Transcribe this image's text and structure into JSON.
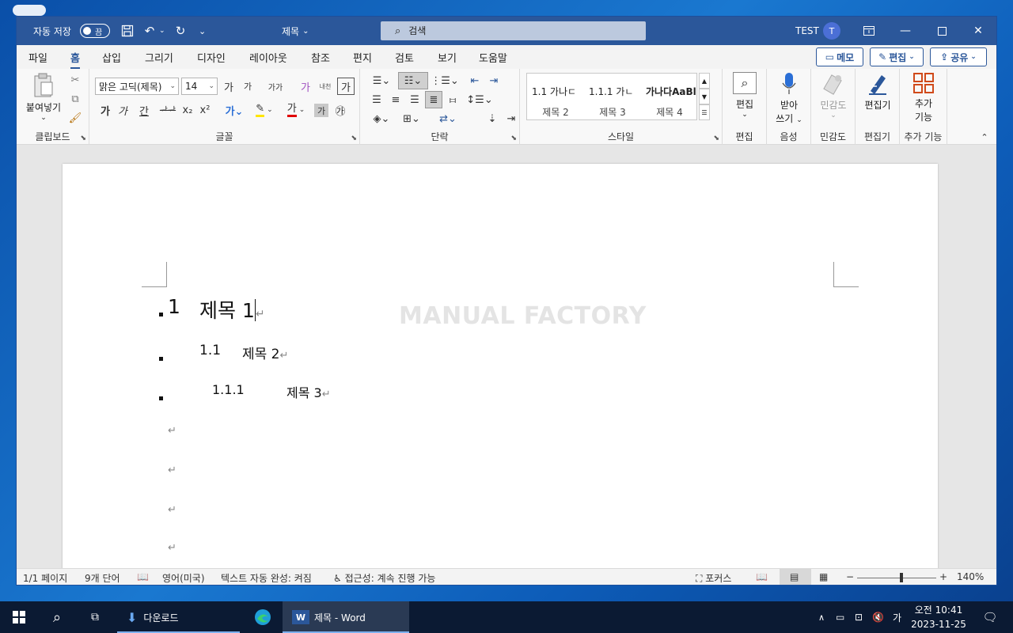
{
  "titlebar": {
    "autosave_label": "자동 저장",
    "autosave_state": "끔",
    "doc_title": "제목",
    "search_placeholder": "검색",
    "user_name": "TEST",
    "avatar_initial": "T"
  },
  "ribbon_tabs": [
    "파일",
    "홈",
    "삽입",
    "그리기",
    "디자인",
    "레이아웃",
    "참조",
    "편지",
    "검토",
    "보기",
    "도움말"
  ],
  "active_tab": "홈",
  "top_buttons": {
    "memo": "메모",
    "edit": "편집",
    "share": "공유"
  },
  "ribbon": {
    "clipboard": {
      "paste_label": "붙여넣기",
      "group": "클립보드"
    },
    "font": {
      "font_name": "맑은 고딕(제목)",
      "font_size": "14",
      "group": "글꼴",
      "bold": "가",
      "italic": "가",
      "underline": "간",
      "clear": "가",
      "phonetic": "내천",
      "charbox": "가",
      "grow": "가",
      "shrink": "가",
      "case": "가가",
      "eraser": "가",
      "fontcolor": "가",
      "shading": "가",
      "circle": "㉮"
    },
    "paragraph": {
      "group": "단락"
    },
    "styles": {
      "group": "스타일",
      "items": [
        {
          "sample": "1.1  가나ㄷ",
          "name": "제목 2"
        },
        {
          "sample": "1.1.1  가ㄴ",
          "name": "제목 3"
        },
        {
          "sample": "가나다AaBl",
          "name": "제목 4"
        }
      ]
    },
    "editing": {
      "label": "편집",
      "group": "편집"
    },
    "voice": {
      "label1": "받아",
      "label2": "쓰기",
      "group": "음성"
    },
    "sensitivity": {
      "label": "민감도",
      "group": "민감도"
    },
    "editor": {
      "label": "편집기",
      "group": "편집기"
    },
    "addins": {
      "label1": "추가",
      "label2": "기능",
      "group": "추가 기능"
    }
  },
  "document": {
    "watermark": "MANUAL FACTORY",
    "h1": {
      "num": "1",
      "text": "제목 1"
    },
    "h2": {
      "num": "1.1",
      "text": "제목 2"
    },
    "h3": {
      "num": "1.1.1",
      "text": "제목 3"
    },
    "para_mark": "↵"
  },
  "statusbar": {
    "page": "1/1 페이지",
    "words": "9개 단어",
    "language": "영어(미국)",
    "autocomplete": "텍스트 자동 완성: 켜짐",
    "accessibility": "접근성: 계속 진행 가능",
    "focus": "포커스",
    "zoom": "140%"
  },
  "taskbar": {
    "downloads": "다운로드",
    "word_app": "제목 - Word",
    "ime": "가",
    "time": "오전 10:41",
    "date": "2023-11-25"
  },
  "colors": {
    "word_blue": "#2b579a",
    "taskbar": "#0b1a33",
    "highlight_yellow": "#ffe600",
    "font_red": "#e00000"
  }
}
